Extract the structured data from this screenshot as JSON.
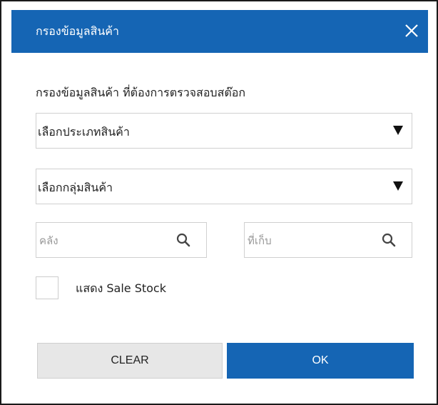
{
  "dialog": {
    "title": "กรองข้อมูลสินค้า",
    "close_glyph": "×",
    "instruction": "กรองข้อมูลสินค้า ที่ต้องการตรวจสอบสต๊อก"
  },
  "filters": {
    "product_type": {
      "label": "เลือกประเภทสินค้า"
    },
    "product_group": {
      "label": "เลือกกลุ่มสินค้า"
    },
    "warehouse": {
      "placeholder": "คลัง",
      "value": ""
    },
    "location": {
      "placeholder": "ที่เก็บ",
      "value": ""
    },
    "show_sale_stock": {
      "label": "แสดง Sale Stock",
      "checked": false
    }
  },
  "buttons": {
    "clear_label": "CLEAR",
    "ok_label": "OK"
  },
  "icons": {
    "close": "close-icon",
    "dropdown": "caret-down-icon",
    "search": "search-icon"
  },
  "colors": {
    "primary": "#1565b4",
    "clear_bg": "#e7e7e7",
    "border": "#d0d0d0"
  }
}
